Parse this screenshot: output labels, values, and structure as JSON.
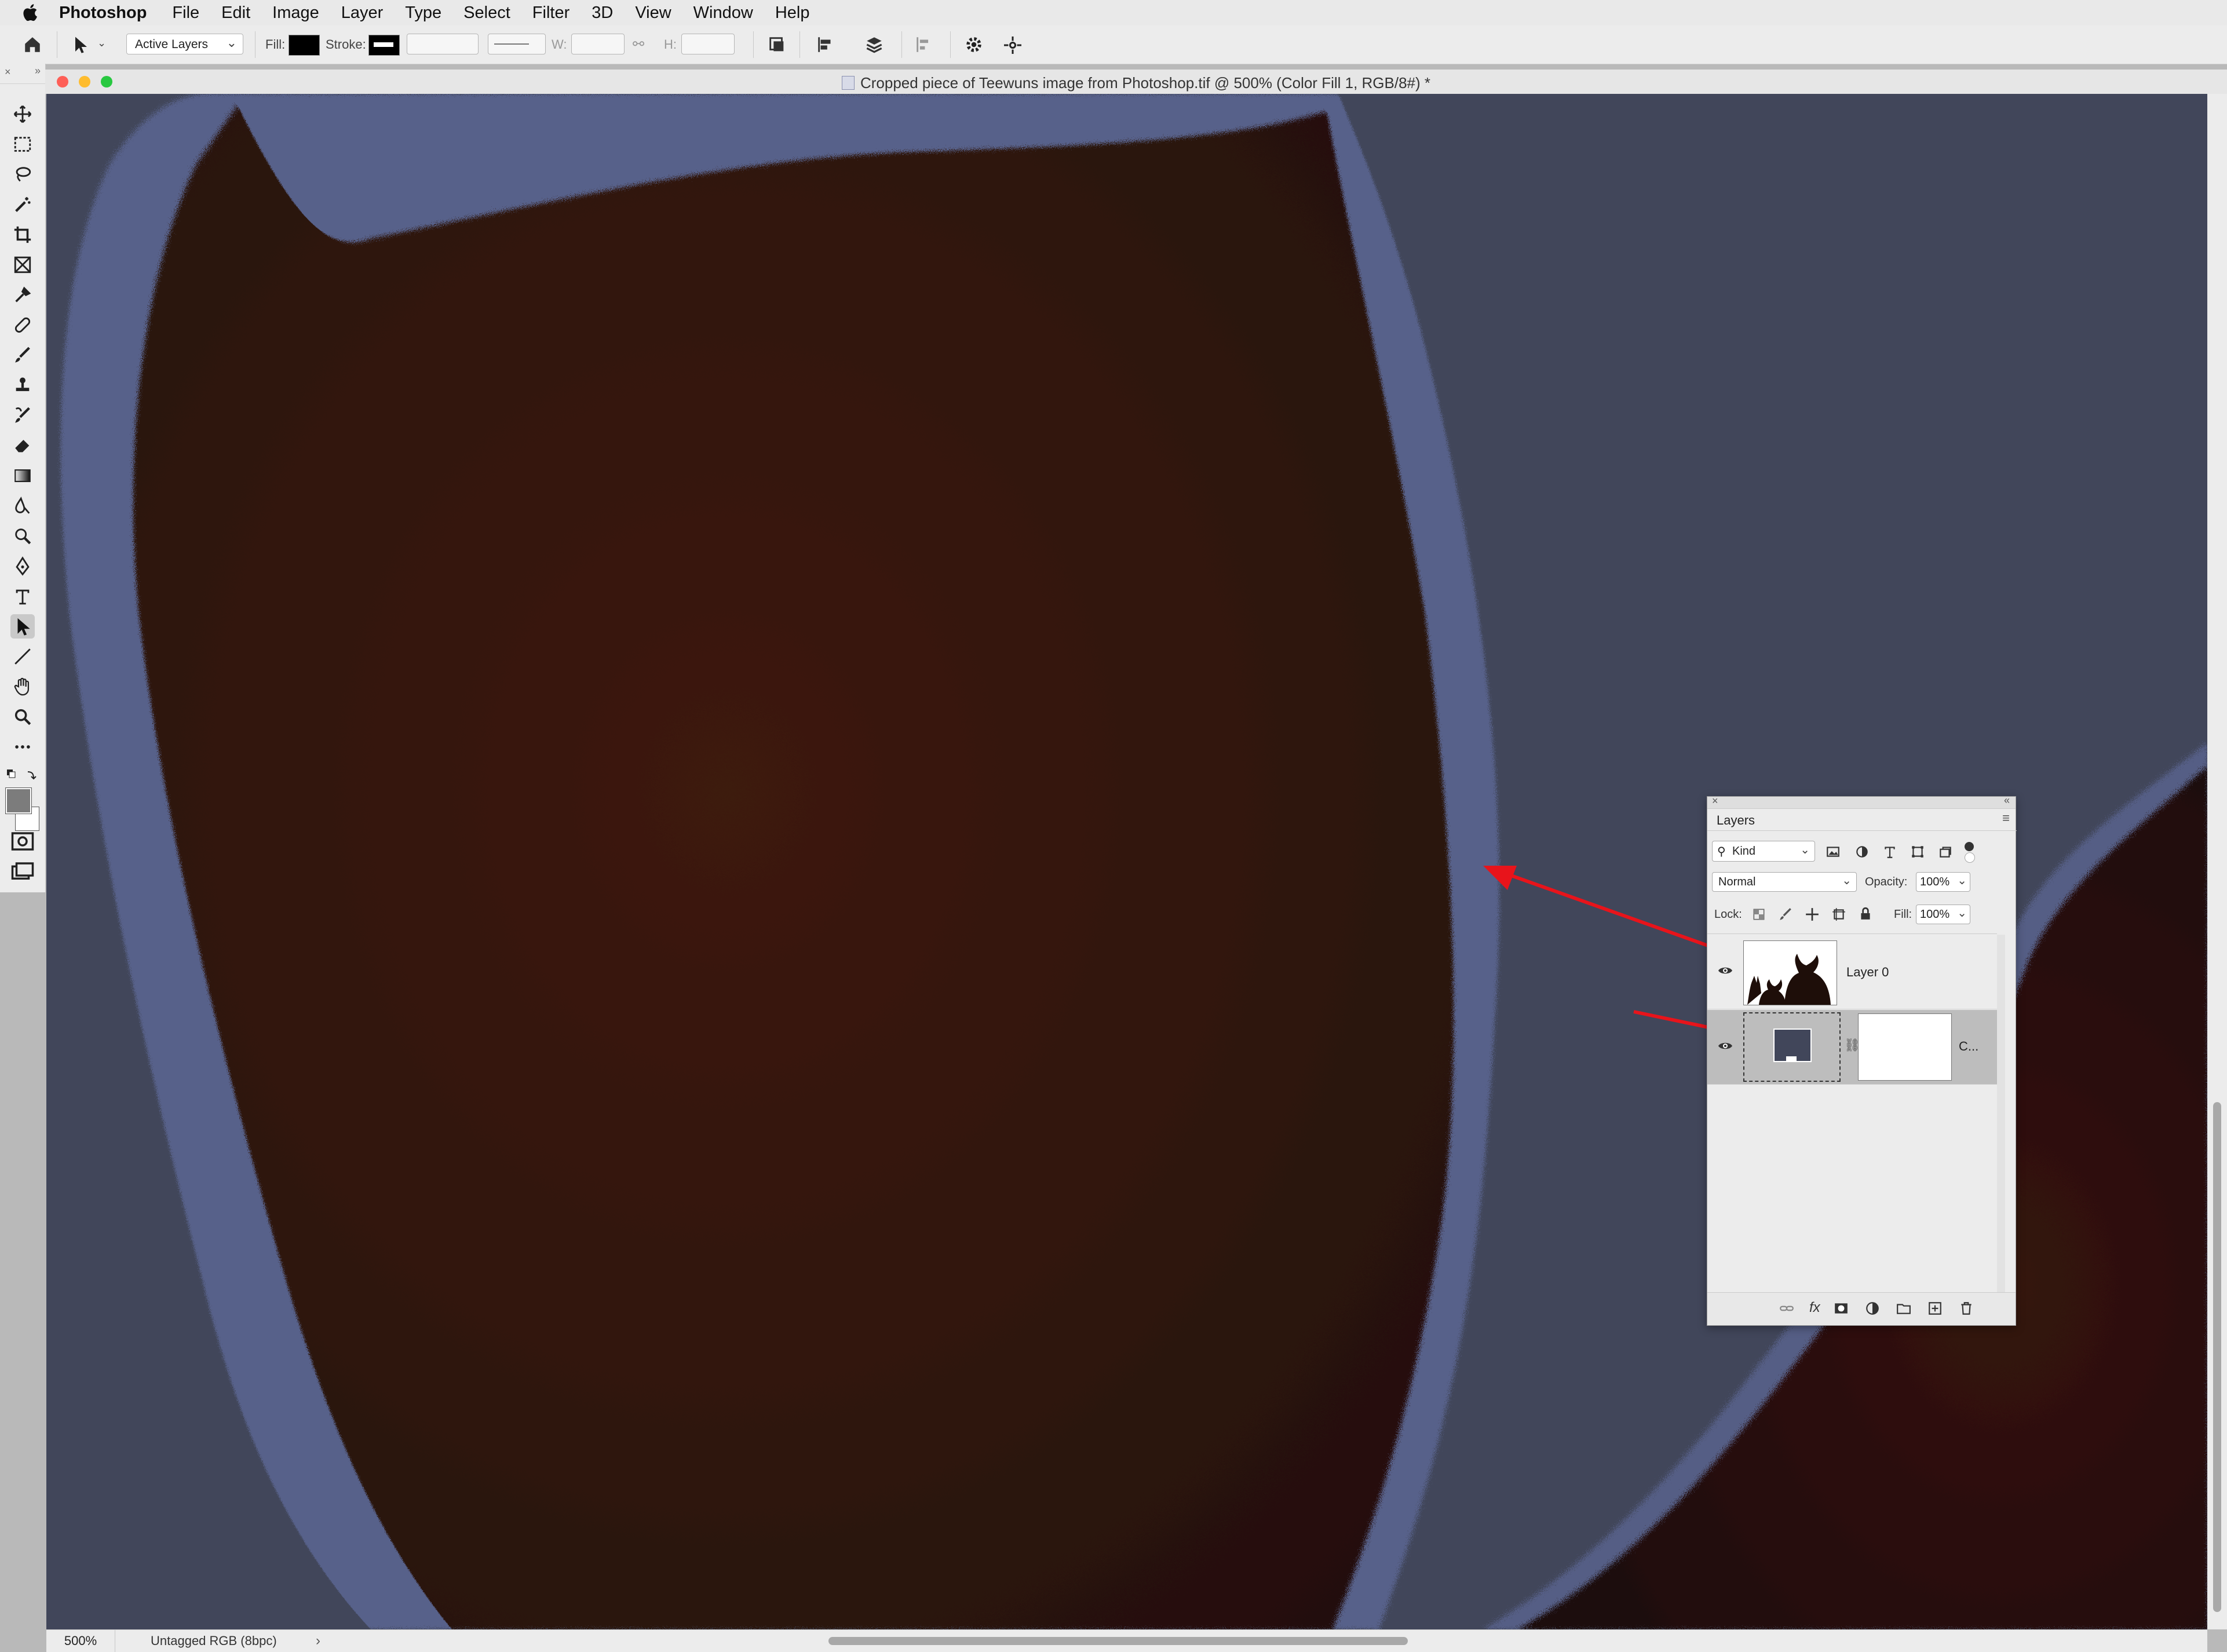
{
  "menubar": {
    "app_name": "Photoshop",
    "items": [
      "File",
      "Edit",
      "Image",
      "Layer",
      "Type",
      "Select",
      "Filter",
      "3D",
      "View",
      "Window",
      "Help"
    ]
  },
  "options_bar": {
    "layers_select": "Active Layers",
    "fill_label": "Fill:",
    "stroke_label": "Stroke:",
    "w_label": "W:",
    "h_label": "H:"
  },
  "document": {
    "title": "Cropped piece of Teewuns image from Photoshop.tif @ 500% (Color Fill 1, RGB/8#) *",
    "zoom": "500%",
    "color_profile": "Untagged RGB (8bpc)",
    "arrow": "›"
  },
  "layers_panel": {
    "tab_title": "Layers",
    "filter_kind": "Kind",
    "blend_mode": "Normal",
    "opacity_label": "Opacity:",
    "opacity_value": "100%",
    "lock_label": "Lock:",
    "fill_label": "Fill:",
    "fill_value": "100%",
    "layers": [
      {
        "name": "Layer 0",
        "visible": true,
        "selected": false
      },
      {
        "name": "C...",
        "visible": true,
        "selected": true
      }
    ]
  },
  "colors": {
    "canvas_background": "#41465a",
    "fur": "#3a1a0e",
    "annotation_arrow": "#e8141b"
  },
  "icons": {
    "tools": [
      "move-icon",
      "marquee-icon",
      "lasso-icon",
      "magic-wand-icon",
      "crop-icon",
      "frame-icon",
      "eyedropper-icon",
      "healing-icon",
      "brush-icon",
      "stamp-icon",
      "history-brush-icon",
      "eraser-icon",
      "gradient-icon",
      "blur-icon",
      "dodge-icon",
      "pen-icon",
      "type-icon",
      "path-selection-icon",
      "line-icon",
      "hand-icon",
      "zoom-icon",
      "more-icon"
    ]
  }
}
